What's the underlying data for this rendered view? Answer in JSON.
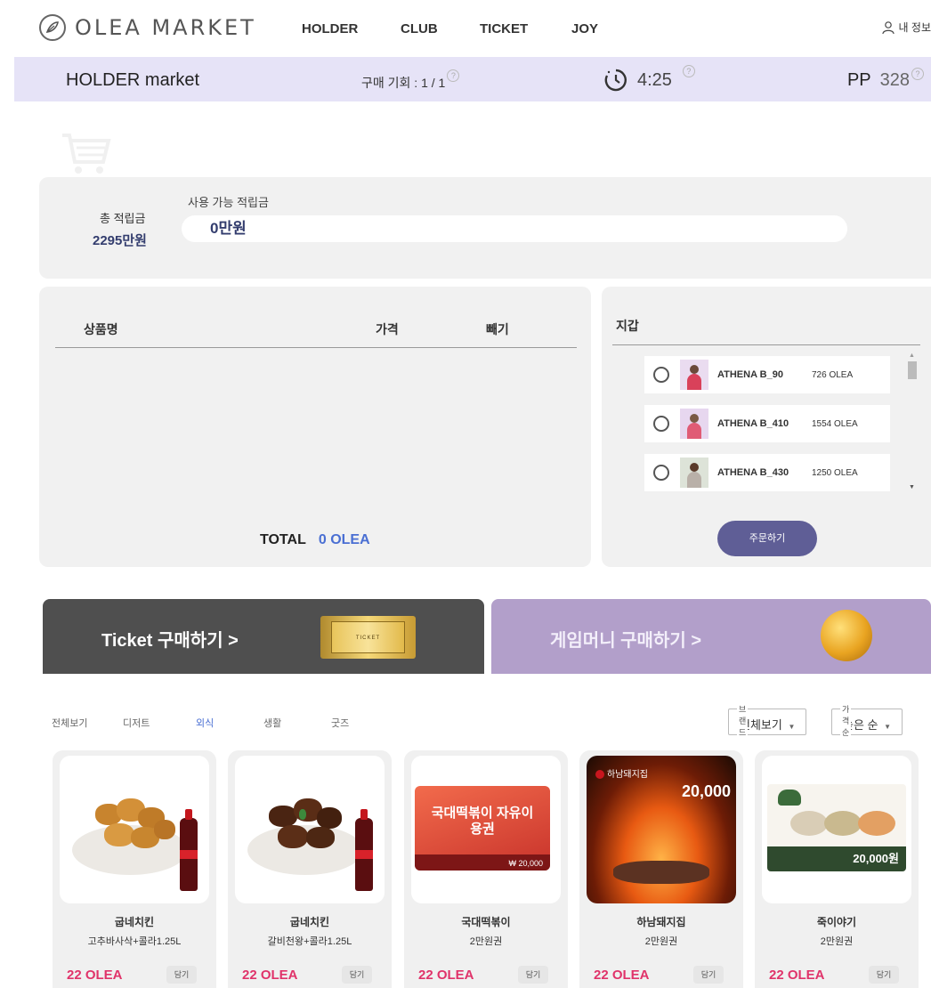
{
  "header": {
    "logo_text": "OLEA MARKET",
    "nav": [
      "HOLDER",
      "CLUB",
      "TICKET",
      "JOY"
    ],
    "user_link": "내 정보"
  },
  "status": {
    "title": "HOLDER market",
    "purchase_chances": "구매 기회 : 1 / 1",
    "timer": "4:25",
    "pp_label": "PP",
    "pp_value": "328",
    "help_glyph": "?"
  },
  "points": {
    "total_label": "총 적립금",
    "total_value": "2295만원",
    "available_label": "사용 가능 적립금",
    "available_value": "0만원"
  },
  "cart": {
    "columns": [
      "상품명",
      "가격",
      "빼기"
    ],
    "total_label": "TOTAL",
    "total_value": "0 OLEA"
  },
  "wallet": {
    "title": "지갑",
    "items": [
      {
        "name": "ATHENA B_90",
        "amount": "726 OLEA"
      },
      {
        "name": "ATHENA B_410",
        "amount": "1554 OLEA"
      },
      {
        "name": "ATHENA B_430",
        "amount": "1250 OLEA"
      }
    ],
    "order_button": "주문하기"
  },
  "banners": {
    "ticket_label": "Ticket 구매하기 >",
    "ticket_image_text": "TICKET",
    "money_label": "게임머니 구매하기 >"
  },
  "filters": {
    "categories": [
      "전체보기",
      "디저트",
      "외식",
      "생활",
      "굿즈"
    ],
    "active_category": "외식",
    "brand_label": "브랜드",
    "brand_value": "전체보기",
    "price_label": "가격순",
    "price_value": "높은 순"
  },
  "products": [
    {
      "name": "굽네치킨",
      "desc": "고추바사삭+콜라1.25L",
      "price": "22 OLEA",
      "button": "담기"
    },
    {
      "name": "굽네치킨",
      "desc": "갈비천왕+콜라1.25L",
      "price": "22 OLEA",
      "button": "담기"
    },
    {
      "name": "국대떡볶이",
      "desc": "2만원권",
      "price": "22 OLEA",
      "button": "담기",
      "image_title": "국대떡볶이 자유이용권",
      "image_amount": "₩ 20,000"
    },
    {
      "name": "하남돼지집",
      "desc": "2만원권",
      "price": "22 OLEA",
      "button": "담기",
      "image_brand": "하남돼지집",
      "image_amount": "20,000"
    },
    {
      "name": "죽이야기",
      "desc": "2만원권",
      "price": "22 OLEA",
      "button": "담기",
      "image_amount": "20,000원"
    }
  ],
  "colors": {
    "status_bar": "#e6e3f7",
    "accent_blue": "#4a6fd3",
    "price_pink": "#e0336a",
    "order_button": "#5f5e96",
    "ticket_banner": "#4f4f4f",
    "money_banner": "#b29fca"
  }
}
